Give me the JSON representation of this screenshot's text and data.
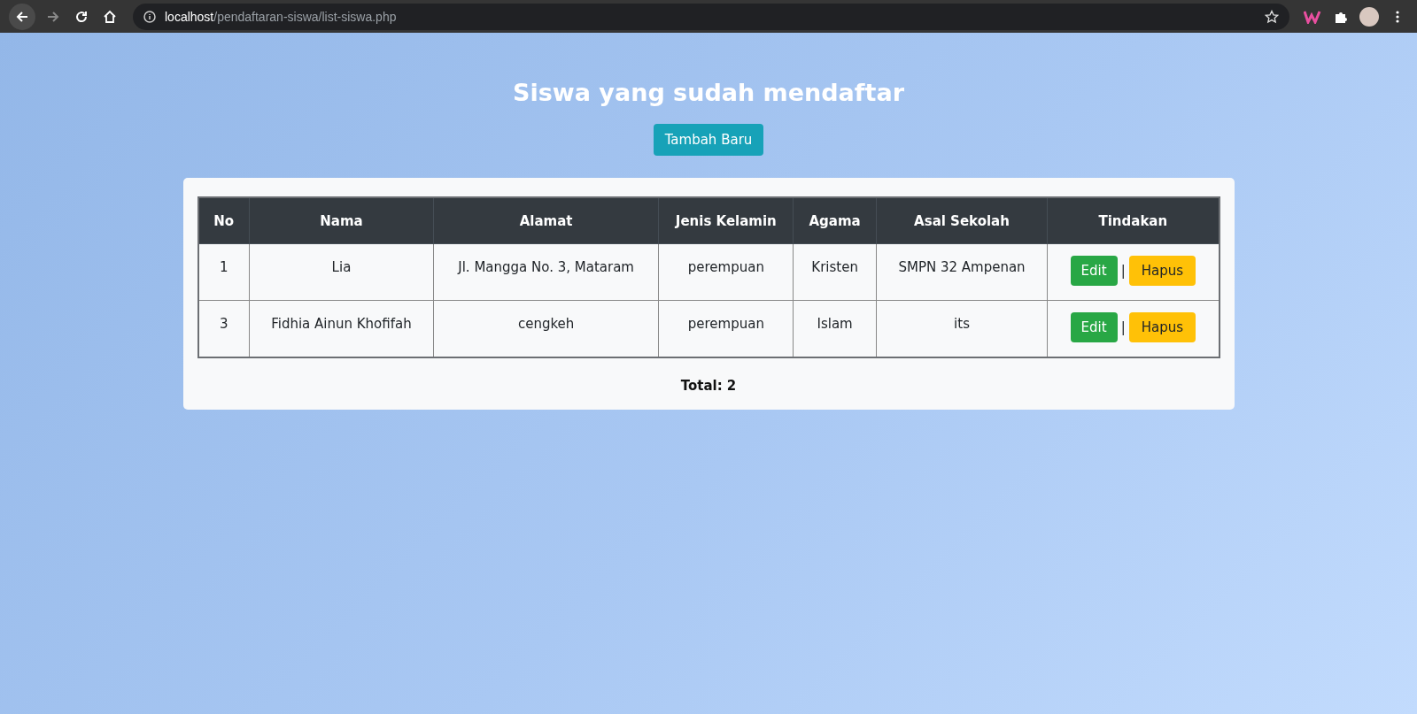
{
  "browser": {
    "url_host": "localhost",
    "url_path": "/pendaftaran-siswa/list-siswa.php"
  },
  "page": {
    "title": "Siswa yang sudah mendaftar",
    "add_button": "Tambah Baru"
  },
  "table": {
    "columns": [
      "No",
      "Nama",
      "Alamat",
      "Jenis Kelamin",
      "Agama",
      "Asal Sekolah",
      "Tindakan"
    ],
    "rows": [
      {
        "cells": [
          "1",
          "Lia",
          "Jl. Mangga No. 3, Mataram",
          "perempuan",
          "Kristen",
          "SMPN 32 Ampenan"
        ],
        "edit": "Edit",
        "separator": "|",
        "delete": "Hapus"
      },
      {
        "cells": [
          "3",
          "Fidhia Ainun Khofifah",
          "cengkeh",
          "perempuan",
          "Islam",
          "its"
        ],
        "edit": "Edit",
        "separator": "|",
        "delete": "Hapus"
      }
    ]
  },
  "total": "Total: 2"
}
